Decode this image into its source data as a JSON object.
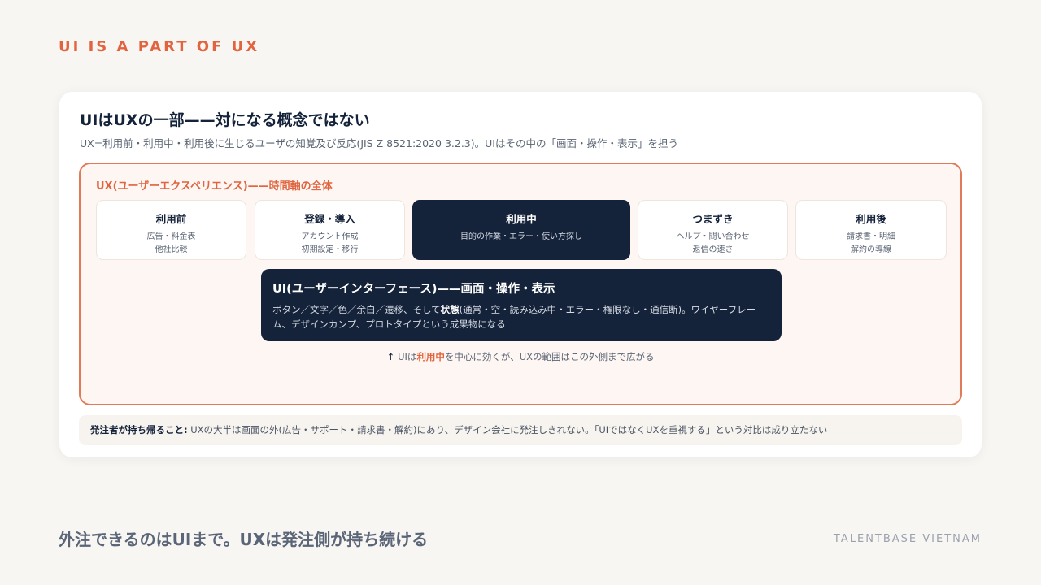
{
  "eyebrow": "UI IS A PART OF UX",
  "card": {
    "title": "UIはUXの一部——対になる概念ではない",
    "subtitle": "UX=利用前・利用中・利用後に生じるユーザの知覚及び反応(JIS Z 8521:2020 3.2.3)。UIはその中の「画面・操作・表示」を担う",
    "ux": {
      "label": "UX(ユーザーエクスペリエンス)——時間軸の全体",
      "stages": [
        {
          "name": "利用前",
          "desc": "広告・料金表\n他社比較"
        },
        {
          "name": "登録・導入",
          "desc": "アカウント作成\n初期設定・移行"
        },
        {
          "name": "利用中",
          "desc": "目的の作業・エラー・使い方探し"
        },
        {
          "name": "つまずき",
          "desc": "ヘルプ・問い合わせ\n返信の速さ"
        },
        {
          "name": "利用後",
          "desc": "請求書・明細\n解約の導線"
        }
      ],
      "ui": {
        "title": "UI(ユーザーインターフェース)——画面・操作・表示",
        "desc_before": "ボタン／文字／色／余白／遷移、そして",
        "desc_bold": "状態",
        "desc_after": "(通常・空・読み込み中・エラー・権限なし・通信断)。ワイヤーフレーム、デザインカンプ、プロトタイプという成果物になる"
      },
      "note": {
        "arrow": "↑",
        "before": "UIは",
        "highlight": "利用中",
        "after": "を中心に効くが、UXの範囲はこの外側まで広がる"
      }
    },
    "takeaway": {
      "label": "発注者が持ち帰ること:",
      "text": " UXの大半は画面の外(広告・サポート・請求書・解約)にあり、デザイン会社に発注しきれない。「UIではなくUXを重視する」という対比は成り立たない"
    }
  },
  "footer": {
    "message": "外注できるのはUIまで。UXは発注側が持ち続ける",
    "brand": "TALENTBASE VIETNAM"
  },
  "colors": {
    "accent": "#e2643f",
    "navy": "#14223a",
    "background": "#f8f6f2"
  }
}
